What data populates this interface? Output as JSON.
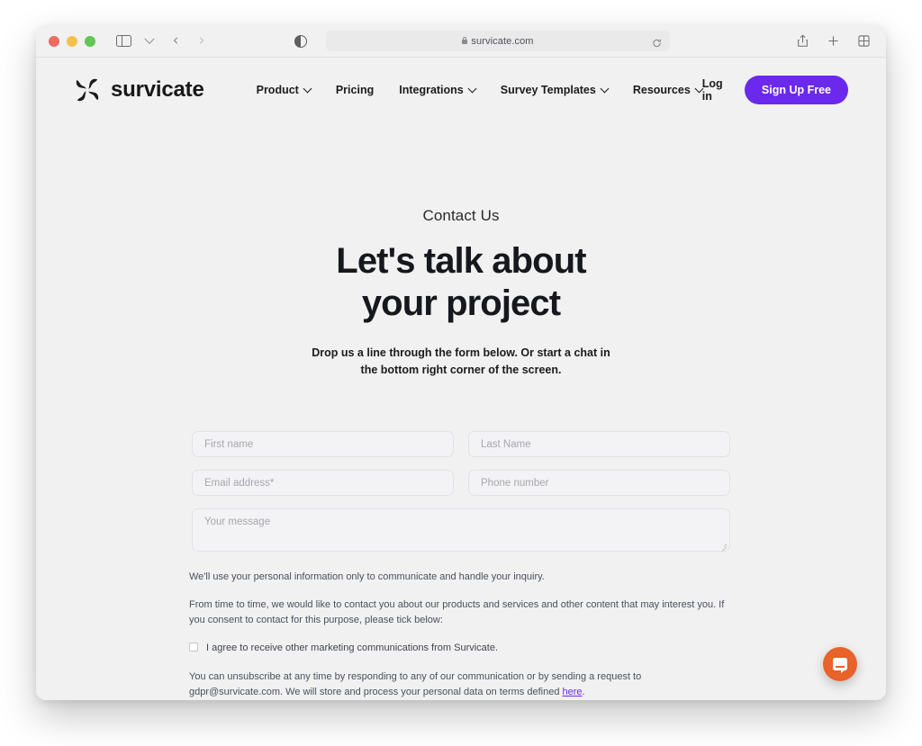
{
  "browser": {
    "url": "survicate.com",
    "icons": {
      "sidebar": "sidebar-toggle-icon",
      "tab_overview": "tab-overview-icon",
      "share": "share-icon",
      "new_tab": "plus-icon",
      "reload": "reload-icon",
      "lock": "lock-icon",
      "contrast": "contrast-icon",
      "back": "‹",
      "forward": "›"
    }
  },
  "site": {
    "brand": "survicate",
    "nav": [
      {
        "label": "Product",
        "has_caret": true
      },
      {
        "label": "Pricing",
        "has_caret": false
      },
      {
        "label": "Integrations",
        "has_caret": true
      },
      {
        "label": "Survey Templates",
        "has_caret": true
      },
      {
        "label": "Resources",
        "has_caret": true
      }
    ],
    "login_label": "Log in",
    "signup_label": "Sign Up Free",
    "accent_color": "#6a29ec"
  },
  "hero": {
    "eyebrow": "Contact Us",
    "headline_line1": "Let's talk about",
    "headline_line2": "your project",
    "subhead_line1": "Drop us a line through the form below. Or start a chat in",
    "subhead_line2": "the bottom right corner of the screen."
  },
  "form": {
    "first_name": {
      "placeholder": "First name",
      "value": ""
    },
    "last_name": {
      "placeholder": "Last Name",
      "value": ""
    },
    "email": {
      "placeholder": "Email address*",
      "value": ""
    },
    "phone": {
      "placeholder": "Phone number",
      "value": ""
    },
    "message": {
      "placeholder": "Your message",
      "value": ""
    }
  },
  "legal": {
    "paragraph1": "We'll use your personal information only to communicate and handle your inquiry.",
    "paragraph2": "From time to time, we would like to contact you about our products and services and other content that may interest you. If you consent to contact for this purpose, please tick below:",
    "consent_label": "I agree to receive other marketing communications from Survicate.",
    "unsubscribe_text": "You can unsubscribe at any time by responding to any of our communication or by sending a request to gdpr@survicate.com. We will store and process your personal data on terms defined ",
    "link_text": "here",
    "period": "."
  },
  "chat": {
    "launcher_name": "intercom-chat-launcher",
    "color": "#e8622a"
  }
}
